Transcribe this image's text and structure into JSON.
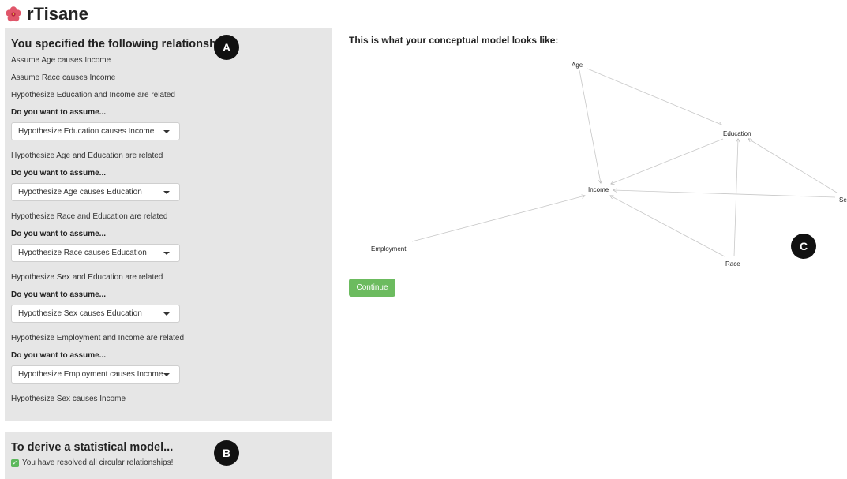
{
  "app": {
    "title": "rTisane"
  },
  "relationships_panel": {
    "heading": "You specified the following relationships:",
    "badge": "A",
    "assume_lines": [
      "Assume Age causes Income",
      "Assume Race causes Income"
    ],
    "questions": [
      {
        "hypothesis": "Hypothesize Education and Income are related",
        "prompt": "Do you want to assume...",
        "selected": "Hypothesize Education causes Income"
      },
      {
        "hypothesis": "Hypothesize Age and Education are related",
        "prompt": "Do you want to assume...",
        "selected": "Hypothesize Age causes Education"
      },
      {
        "hypothesis": "Hypothesize Race and Education are related",
        "prompt": "Do you want to assume...",
        "selected": "Hypothesize Race causes Education"
      },
      {
        "hypothesis": "Hypothesize Sex and Education are related",
        "prompt": "Do you want to assume...",
        "selected": "Hypothesize Sex causes Education"
      },
      {
        "hypothesis": "Hypothesize Employment and Income are related",
        "prompt": "Do you want to assume...",
        "selected": "Hypothesize Employment causes Income"
      }
    ],
    "final_line": "Hypothesize Sex causes Income"
  },
  "statistical_panel": {
    "heading": "To derive a statistical model...",
    "badge": "B",
    "status": "You have resolved all circular relationships!"
  },
  "model_view": {
    "title": "This is what your conceptual model looks like:",
    "badge": "C",
    "nodes": [
      "Age",
      "Education",
      "Income",
      "Sex",
      "Employment",
      "Race"
    ],
    "edges": [
      [
        "Age",
        "Income"
      ],
      [
        "Age",
        "Education"
      ],
      [
        "Education",
        "Income"
      ],
      [
        "Sex",
        "Income"
      ],
      [
        "Sex",
        "Education"
      ],
      [
        "Employment",
        "Income"
      ],
      [
        "Race",
        "Income"
      ],
      [
        "Race",
        "Education"
      ]
    ],
    "continue_label": "Continue"
  },
  "colors": {
    "panel_bg": "#e6e6e6",
    "continue_green": "#6cbb5f",
    "badge_black": "#111111",
    "edge_gray": "#c8c8c8"
  }
}
